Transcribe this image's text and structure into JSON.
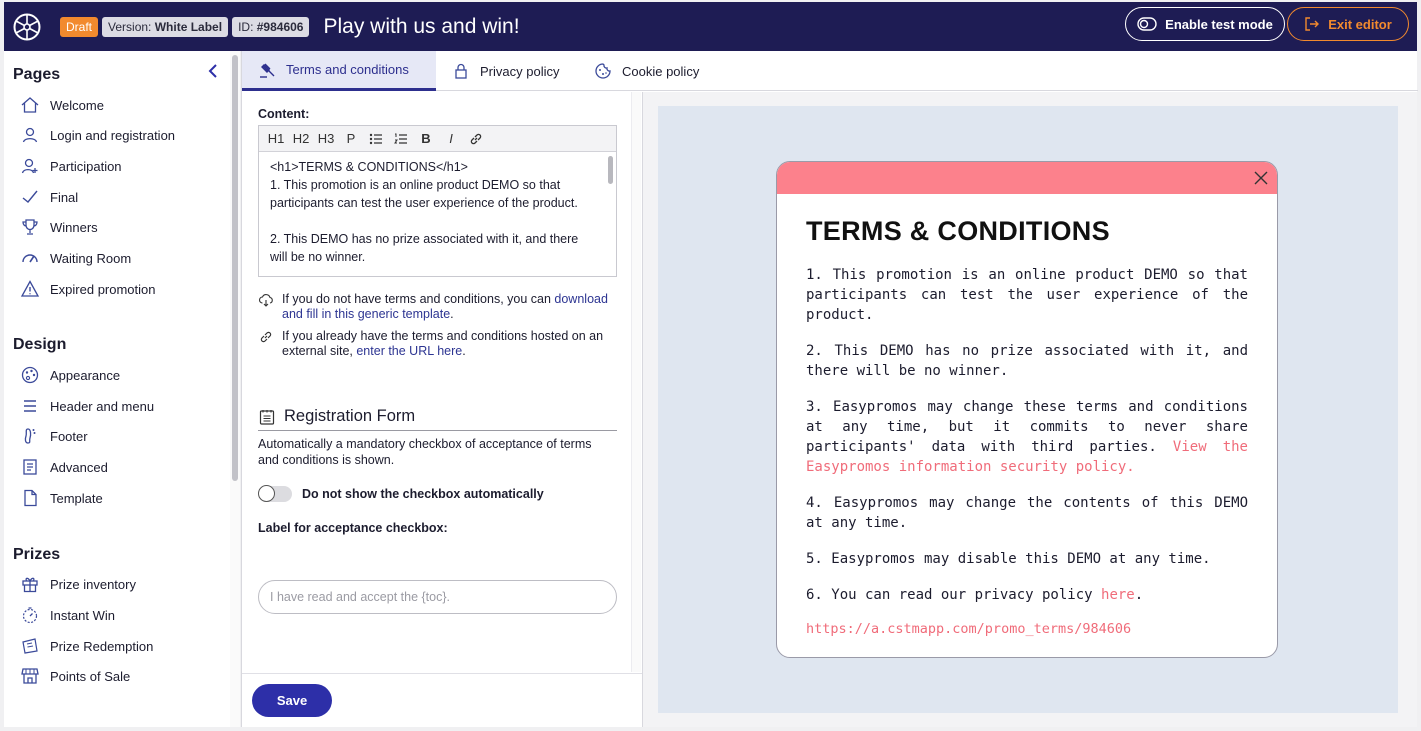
{
  "header": {
    "badge_draft": "Draft",
    "version_label": "Version:",
    "version_value": "White Label",
    "id_label": "ID:",
    "id_value": "#984606",
    "title": "Play with us and win!",
    "test_mode_label": "Enable test mode",
    "exit_label": "Exit editor"
  },
  "sidebar": {
    "pages_heading": "Pages",
    "pages": [
      "Welcome",
      "Login and registration",
      "Participation",
      "Final",
      "Winners",
      "Waiting Room",
      "Expired promotion"
    ],
    "design_heading": "Design",
    "design": [
      "Appearance",
      "Header and menu",
      "Footer",
      "Advanced",
      "Template"
    ],
    "prizes_heading": "Prizes",
    "prizes": [
      "Prize inventory",
      "Instant Win",
      "Prize Redemption",
      "Points of Sale"
    ]
  },
  "tabs": [
    "Terms and conditions",
    "Privacy policy",
    "Cookie policy"
  ],
  "form": {
    "content_label": "Content:",
    "toolbar": [
      "H1",
      "H2",
      "H3",
      "P",
      "B",
      "I"
    ],
    "content_text": "<h1>TERMS & CONDITIONS</h1>\n1.  This promotion is an online product DEMO so that participants can test the user experience of the product.\n\n2. This DEMO has no prize associated with it, and there will be no winner.",
    "hint1_text": "If you do not have terms and conditions, you can",
    "hint1_link": "download and fill in this generic template",
    "hint2_text": "If you already have the terms and conditions hosted on an external site,",
    "hint2_link": "enter the URL here",
    "registration_title": "Registration Form",
    "registration_desc": "Automatically a mandatory checkbox of acceptance of terms and conditions is shown.",
    "toggle_label": "Do not show the checkbox automatically",
    "toggle_on": false,
    "checkbox_label": "Label for acceptance checkbox:",
    "checkbox_placeholder": "I have read and accept the {toc}.",
    "save_label": "Save"
  },
  "preview": {
    "heading": "TERMS & CONDITIONS",
    "p1": "1. This promotion is an online product DEMO so that participants can test the user experience of the product.",
    "p2": "2. This DEMO has no prize associated with it, and there will be no winner.",
    "p3": "3. Easypromos may change these terms and conditions at any time, but it commits to never share participants' data with third parties.",
    "p3_link": "View the Easypromos information security policy.",
    "p4": "4. Easypromos may change the contents of this DEMO at any time.",
    "p5": "5. Easypromos may disable this DEMO at any time.",
    "p6": "6. You can read our privacy policy",
    "p6_link": "here",
    "url": "https://a.cstmapp.com/promo_terms/984606"
  },
  "colors": {
    "topbar": "#1e1c54",
    "accent": "#2d2fa8",
    "draft": "#f28a2e",
    "modal_header": "#fc818c",
    "link_pink": "#f06c7a"
  }
}
